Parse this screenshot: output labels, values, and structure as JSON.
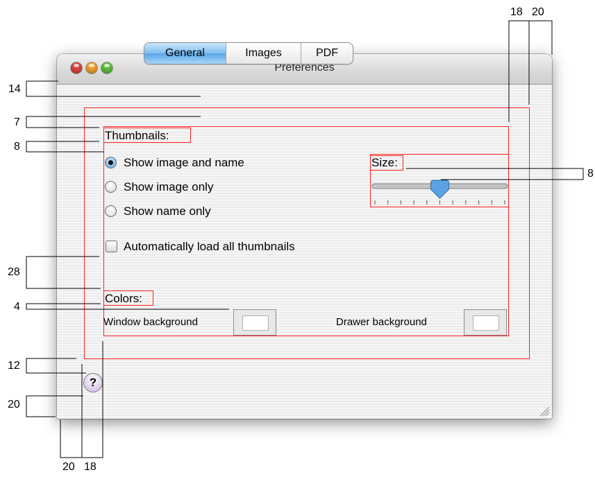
{
  "window": {
    "title": "Preferences",
    "traffic_lights": {
      "close_color": "#e0443e",
      "minimize_color": "#f3a22d",
      "zoom_color": "#5cc23a"
    }
  },
  "tabs": [
    {
      "label": "General",
      "selected": true
    },
    {
      "label": "Images",
      "selected": false
    },
    {
      "label": "PDF",
      "selected": false
    }
  ],
  "thumbnails": {
    "heading": "Thumbnails:",
    "options": [
      {
        "label": "Show image and name",
        "selected": true
      },
      {
        "label": "Show image only",
        "selected": false
      },
      {
        "label": "Show name only",
        "selected": false
      }
    ],
    "auto_load_label": "Automatically load all thumbnails",
    "auto_load_checked": false
  },
  "size": {
    "heading": "Size:",
    "slider_value_fraction": 0.5,
    "tick_count": 11
  },
  "colors": {
    "heading": "Colors:",
    "window_background_label": "Window background",
    "drawer_background_label": "Drawer background"
  },
  "help_button": {
    "label": "?"
  },
  "measurements": {
    "top_18": "18",
    "top_20": "20",
    "left_14": "14",
    "left_7": "7",
    "left_8": "8",
    "left_28": "28",
    "left_4": "4",
    "left_12": "12",
    "left_20": "20",
    "right_8": "8",
    "bottom_20": "20",
    "bottom_18": "18"
  },
  "colors_meta": {
    "redline": "#ff2020",
    "tab_selected": "#6fb4ee"
  }
}
